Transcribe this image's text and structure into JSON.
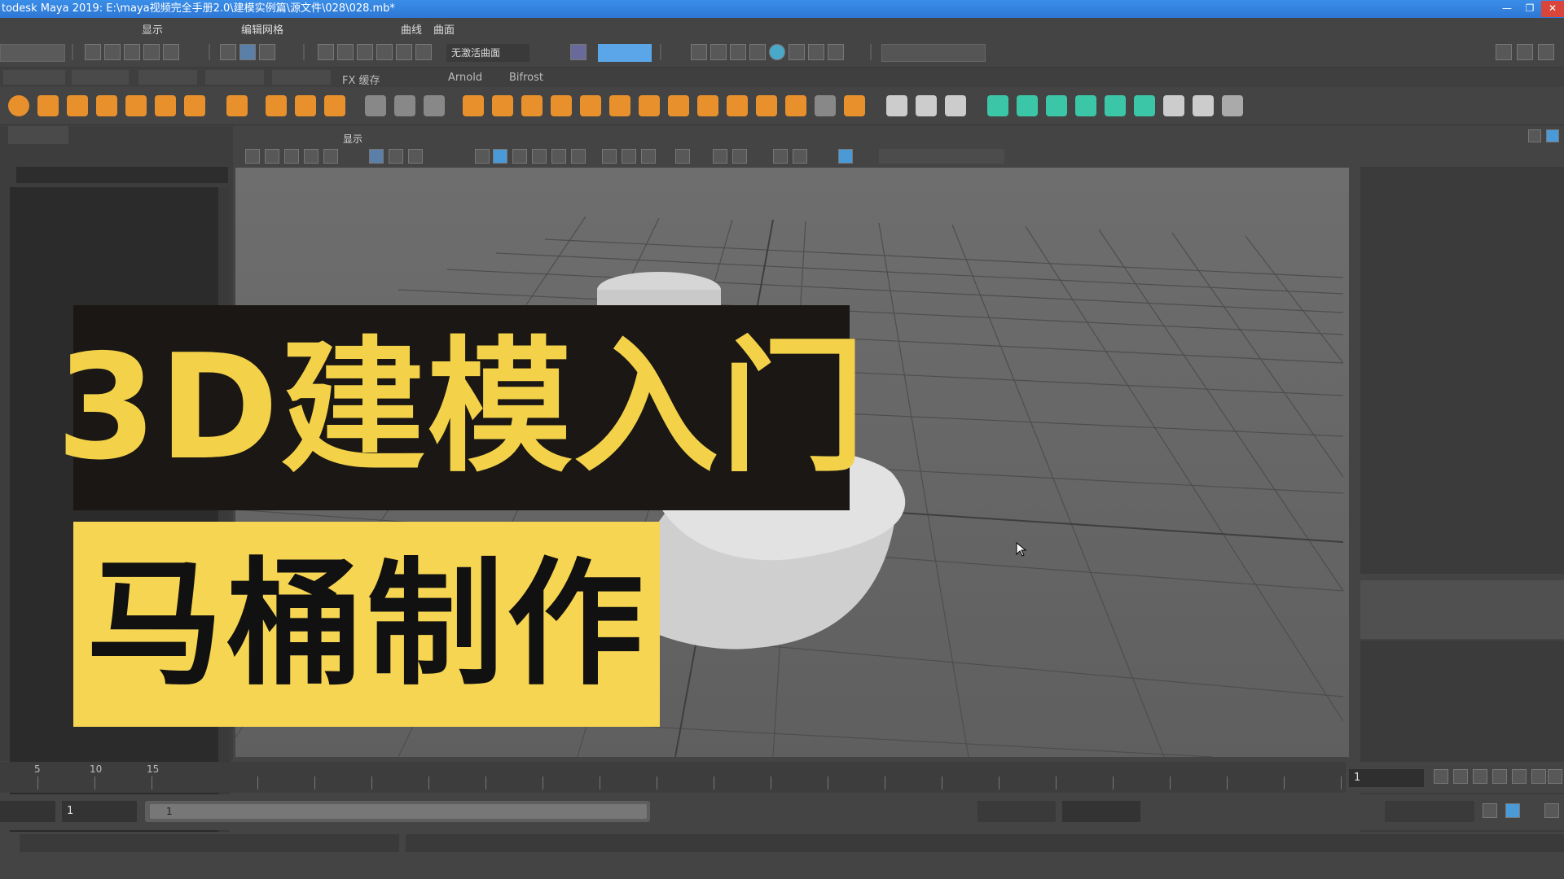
{
  "window": {
    "title": "todesk Maya 2019: E:\\maya视频完全手册2.0\\建模实例篇\\源文件\\028\\028.mb*",
    "controls": [
      "minimize-icon",
      "restore-icon",
      "close-icon"
    ]
  },
  "menubar": {
    "items": [
      "显示",
      "编辑网格",
      "曲线",
      "曲面"
    ]
  },
  "statusline": {
    "surface_field": "无激活曲面"
  },
  "shelf_tabs": {
    "items": [
      "FX 缓存",
      "Arnold",
      "Bifrost"
    ]
  },
  "viewport": {
    "menu_label": "显示"
  },
  "overlay": {
    "title": "3D建模入门",
    "subtitle": "马桶制作",
    "title_bg": "#1a1714",
    "title_color": "#f3d249",
    "subtitle_bg": "#f6d552",
    "subtitle_color": "#111111"
  },
  "timeline": {
    "tick_labels": [
      "5",
      "10",
      "15"
    ],
    "current_frame": "1"
  },
  "range_slider": {
    "start_field": "1",
    "inner_start": "1"
  }
}
